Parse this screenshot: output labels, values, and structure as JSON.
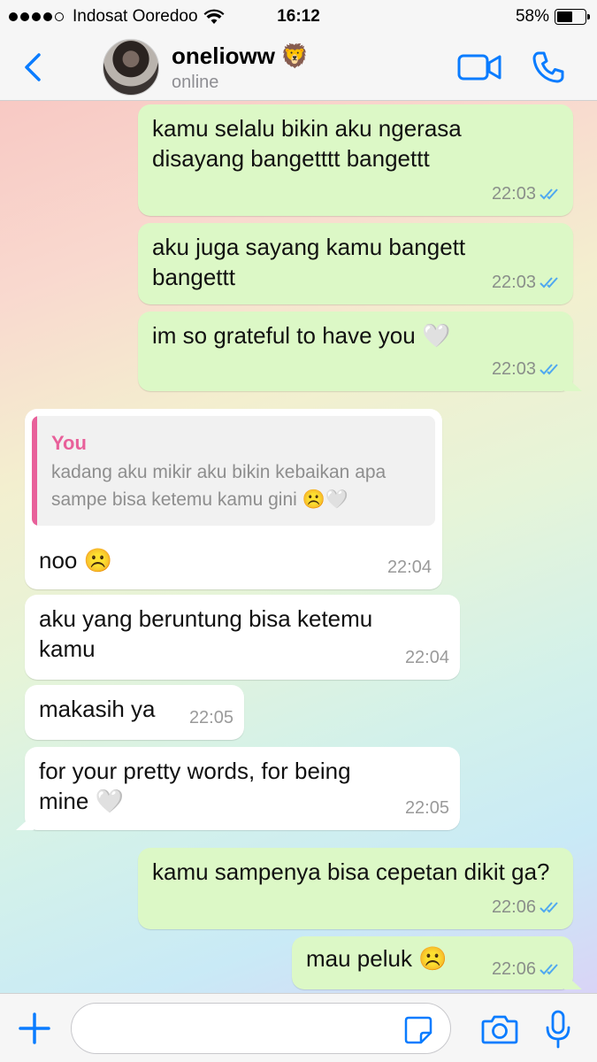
{
  "status_bar": {
    "carrier": "Indosat Ooredoo",
    "time": "16:12",
    "battery_percent": "58%",
    "battery_level": 0.58,
    "signal_bars_filled": 4,
    "signal_bars_total": 5
  },
  "header": {
    "contact_name": "onelioww",
    "name_emoji": "🦁",
    "status": "online",
    "accent_color": "#0a7cff"
  },
  "messages": [
    {
      "direction": "outgoing",
      "text": "kamu selalu bikin aku ngerasa disayang bangetttt bangettt",
      "time": "22:03",
      "read": true
    },
    {
      "direction": "outgoing",
      "text": "aku juga sayang kamu bangett bangettt",
      "time": "22:03",
      "read": true
    },
    {
      "direction": "outgoing",
      "text": "im so grateful to have you 🤍",
      "time": "22:03",
      "read": true
    },
    {
      "direction": "incoming",
      "quote": {
        "author": "You",
        "text": "kadang aku mikir aku bikin kebaikan apa sampe bisa ketemu kamu gini ☹️🤍"
      },
      "text": "noo ☹️",
      "time": "22:04"
    },
    {
      "direction": "incoming",
      "text": "aku yang beruntung bisa ketemu kamu",
      "time": "22:04"
    },
    {
      "direction": "incoming",
      "text": "makasih ya",
      "time": "22:05"
    },
    {
      "direction": "incoming",
      "text": "for your pretty words, for being mine 🤍",
      "time": "22:05"
    },
    {
      "direction": "outgoing",
      "text": "kamu sampenya bisa cepetan dikit ga?",
      "time": "22:06",
      "read": true
    },
    {
      "direction": "outgoing",
      "text": "mau peluk ☹️",
      "time": "22:06",
      "read": true
    }
  ],
  "input": {
    "value": "",
    "placeholder": ""
  },
  "colors": {
    "outgoing_bubble": "#dcf8c6",
    "incoming_bubble": "#ffffff",
    "read_ticks": "#4fa8f0",
    "quote_accent": "#e8609a"
  }
}
